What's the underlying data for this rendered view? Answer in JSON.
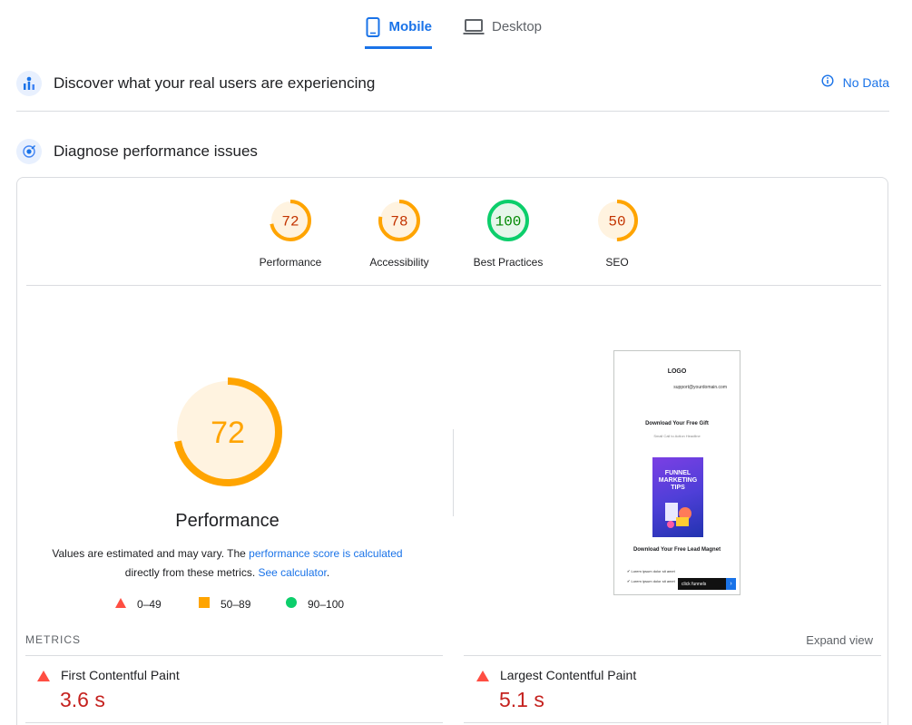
{
  "tabs": {
    "mobile": "Mobile",
    "desktop": "Desktop"
  },
  "field_data": {
    "title": "Discover what your real users are experiencing",
    "status": "No Data"
  },
  "lab": {
    "title": "Diagnose performance issues"
  },
  "scores": [
    {
      "label": "Performance",
      "value": "72",
      "score": 72,
      "color": "#ffa400",
      "text_color": "#c33300",
      "bg": "#fff3e0"
    },
    {
      "label": "Accessibility",
      "value": "78",
      "score": 78,
      "color": "#ffa400",
      "text_color": "#c33300",
      "bg": "#fff3e0"
    },
    {
      "label": "Best Practices",
      "value": "100",
      "score": 100,
      "color": "#0cce6b",
      "text_color": "#008800",
      "bg": "#e6f6ea"
    },
    {
      "label": "SEO",
      "value": "50",
      "score": 50,
      "color": "#ffa400",
      "text_color": "#c33300",
      "bg": "#fff3e0"
    }
  ],
  "performance": {
    "score": "72",
    "title": "Performance",
    "desc_1": "Values are estimated and may vary. The ",
    "link_1": "performance score is calculated",
    "desc_2": "directly from these metrics. ",
    "link_2": "See calculator",
    "desc_3": "."
  },
  "legend": [
    {
      "range": "0–49",
      "shape": "triangle",
      "color": "#ff4e42"
    },
    {
      "range": "50–89",
      "shape": "square",
      "color": "#ffa400"
    },
    {
      "range": "90–100",
      "shape": "circle",
      "color": "#0cce6b"
    }
  ],
  "screenshot": {
    "logo": "LOGO",
    "email": "support@yourdomain.com",
    "heading": "Download Your Free Gift",
    "subheading": "Small Call to Action Headline",
    "book_title": "FUNNEL MARKETING TIPS",
    "heading2": "Download Your Free Lead Magnet",
    "bullet_1": "Lorem ipsum dolor sit amet",
    "bullet_2": "Lorem ipsum dolor sit amet",
    "badge": "click funnels"
  },
  "metrics": {
    "label": "METRICS",
    "expand": "Expand view",
    "items": [
      {
        "name": "First Contentful Paint",
        "value": "3.6 s",
        "color": "#c5221f"
      },
      {
        "name": "Largest Contentful Paint",
        "value": "5.1 s",
        "color": "#c5221f"
      }
    ]
  }
}
